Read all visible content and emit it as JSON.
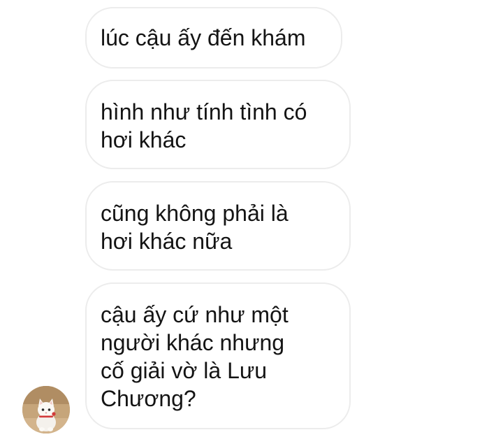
{
  "thread": {
    "messages": [
      {
        "lines": [
          "lúc cậu ấy đến khám"
        ]
      },
      {
        "lines": [
          "hình như tính tình có",
          "hơi khác"
        ]
      },
      {
        "lines": [
          "cũng không phải là",
          "hơi khác nữa"
        ]
      },
      {
        "lines": [
          "cậu ấy cứ như một",
          "người khác nhưng",
          "cố giải vờ là Lưu",
          "Chương?"
        ]
      }
    ]
  },
  "avatar": {
    "icon": "white-kitten-avatar-icon"
  },
  "colors": {
    "background": "#ffffff",
    "bubble_border": "#ececec",
    "text": "#141414"
  }
}
